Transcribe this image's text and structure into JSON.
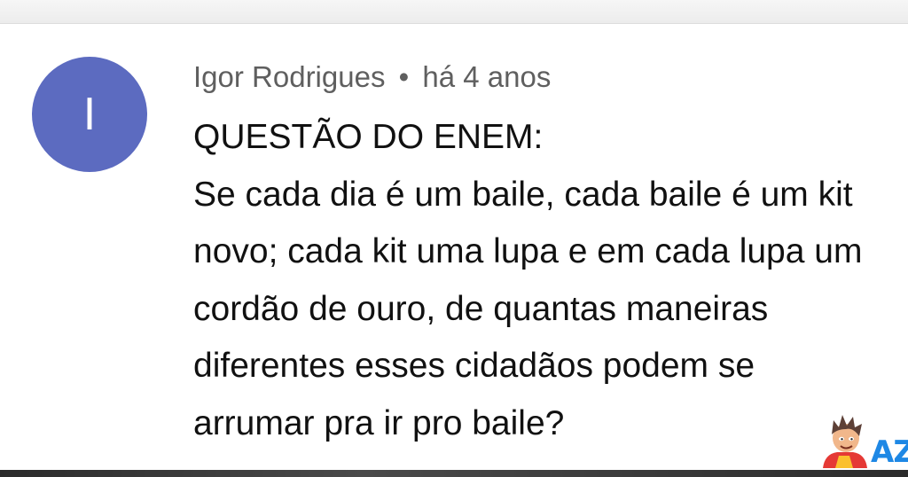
{
  "comment": {
    "avatar_letter": "I",
    "author": "Igor Rodrigues",
    "separator": "•",
    "timestamp": "há 4 anos",
    "lines": [
      "QUESTÃO DO ENEM:",
      "Se cada dia é um baile, cada baile é um kit",
      "novo; cada kit uma lupa e em cada lupa um",
      "cordão de ouro, de quantas maneiras",
      "diferentes esses cidadãos podem se",
      "arrumar pra ir pro baile?"
    ]
  },
  "watermark": {
    "text": "AZ"
  },
  "colors": {
    "avatar_bg": "#5c6bc0",
    "meta_text": "#5f5f5f",
    "body_text": "#111111",
    "watermark_blue": "#1e88e5"
  }
}
